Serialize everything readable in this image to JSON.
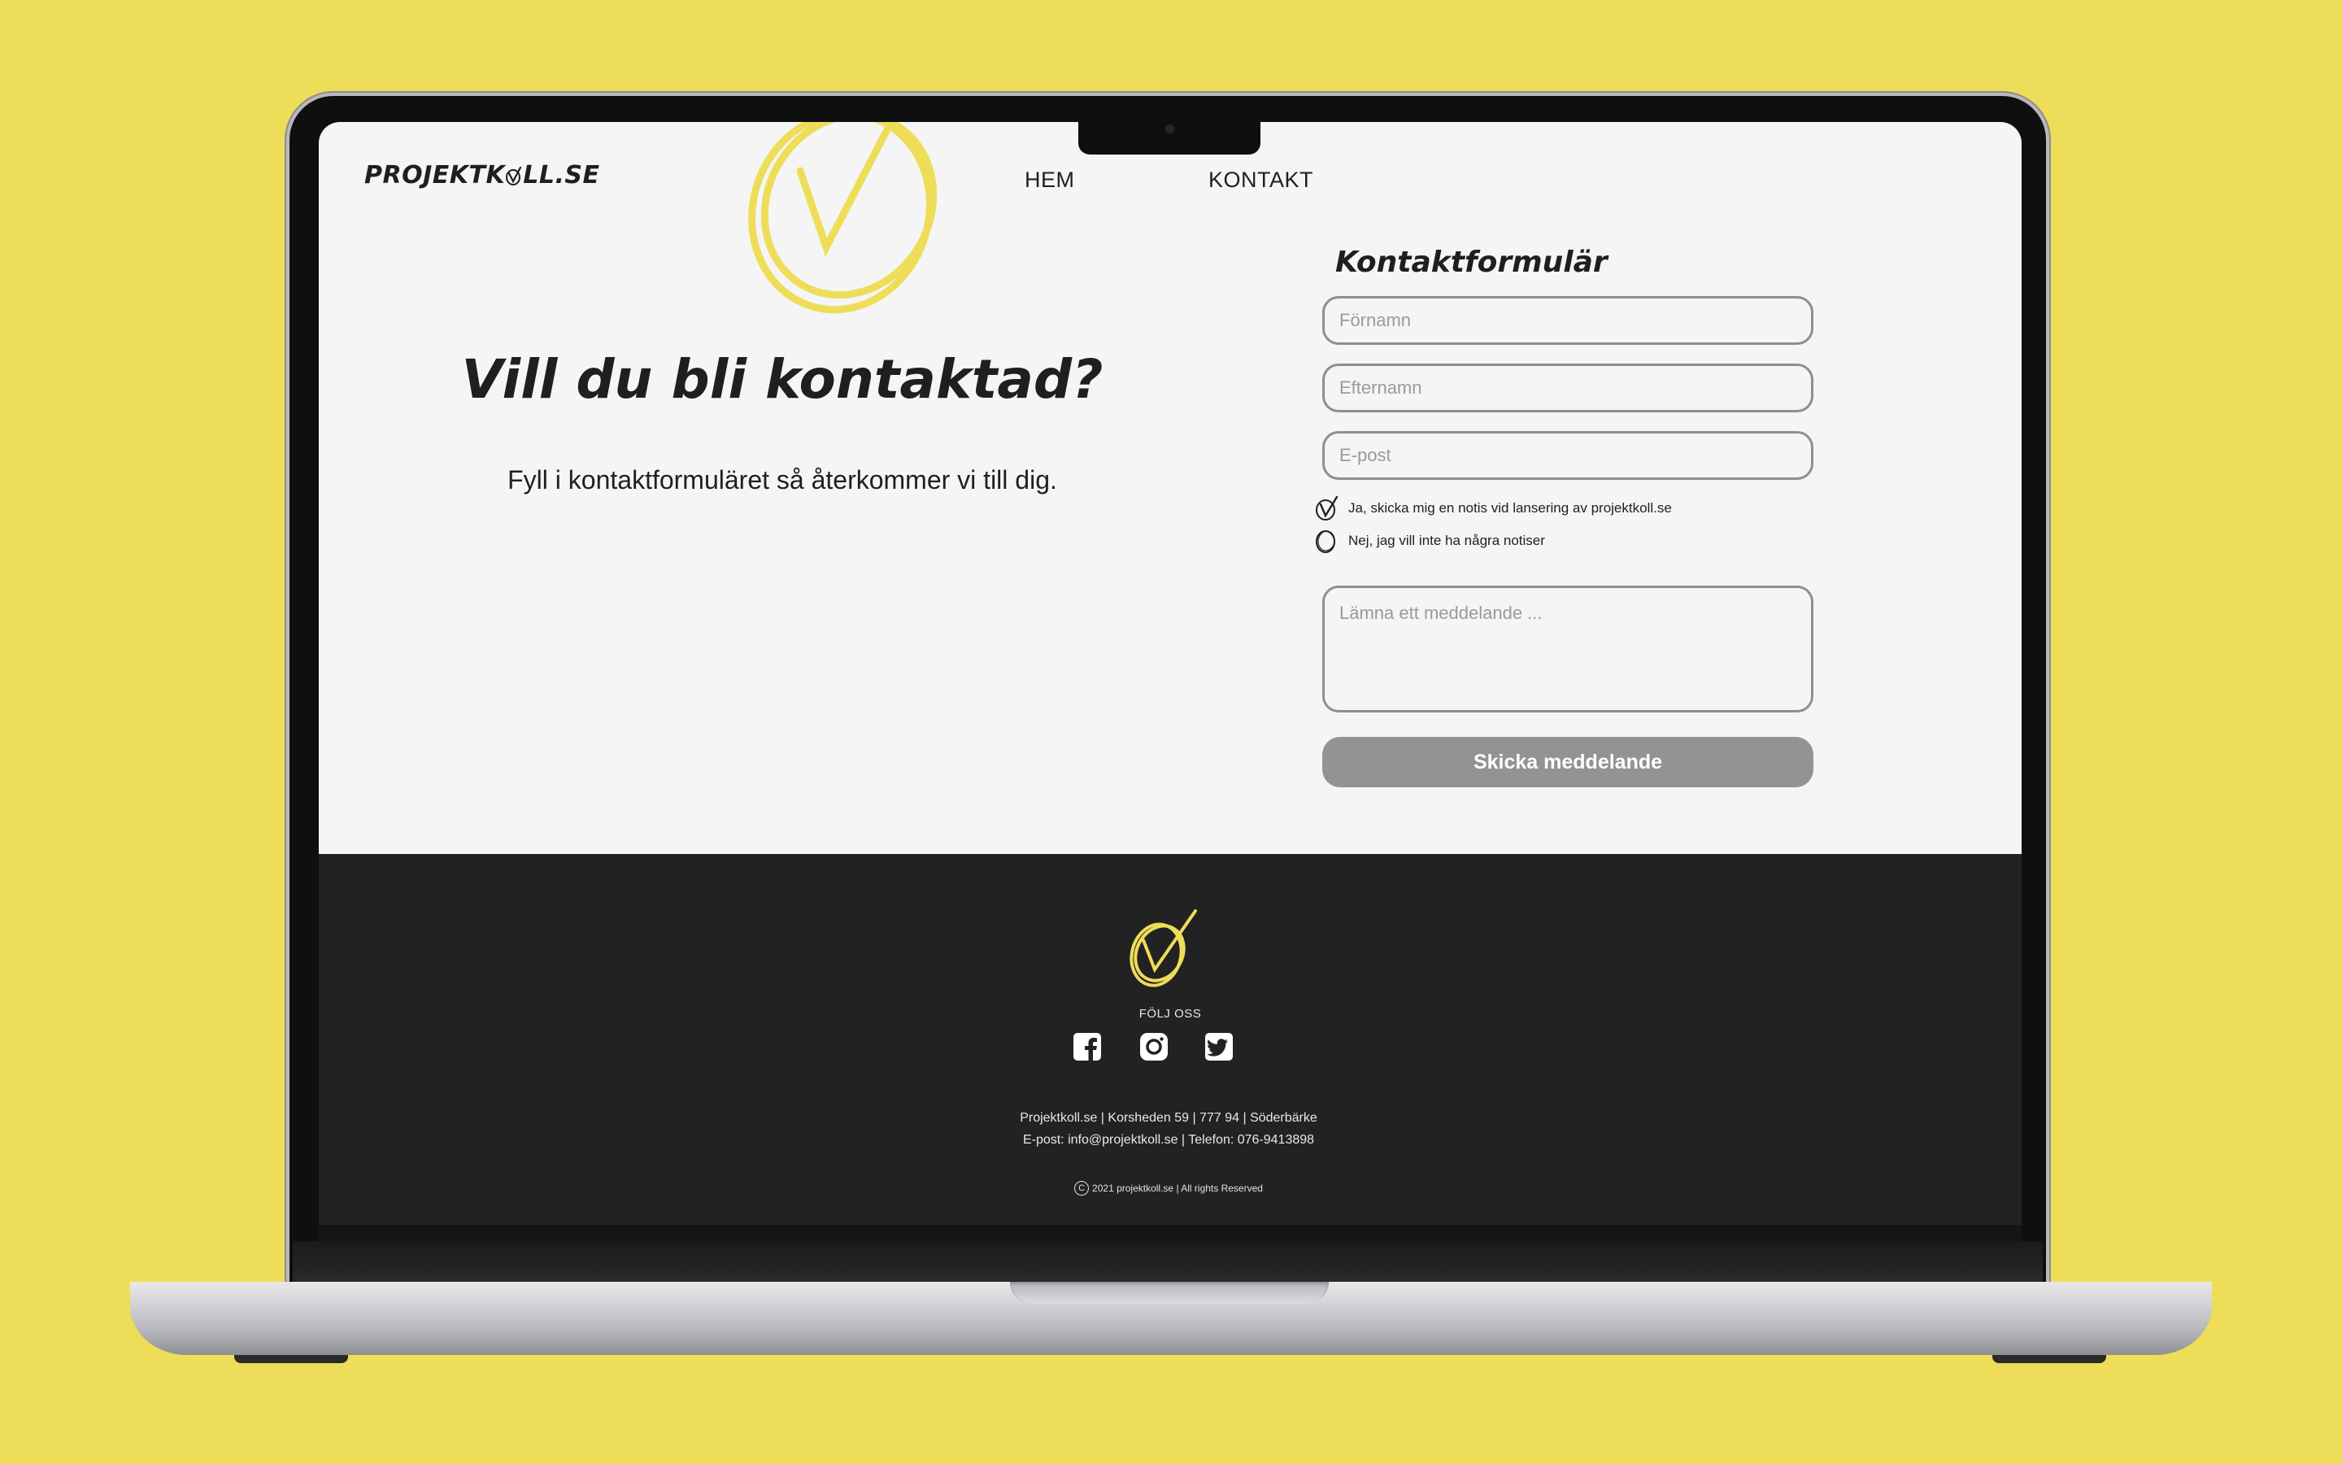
{
  "colors": {
    "background": "#EEDD58",
    "accent_yellow": "#EEDD58",
    "page_bg": "#F5F5F5",
    "footer_bg": "#222222",
    "button_bg": "#939393",
    "text": "#1f1f1f"
  },
  "header": {
    "brand_prefix": "PROJEKTK",
    "brand_suffix": "LL.SE",
    "nav": [
      "HEM",
      "KONTAKT"
    ]
  },
  "hero": {
    "headline": "Vill du bli kontaktad?",
    "subline": "Fyll i kontaktformuläret så återkommer vi till dig."
  },
  "form": {
    "title": "Kontaktformulär",
    "first_name_placeholder": "Förnamn",
    "last_name_placeholder": "Efternamn",
    "email_placeholder": "E-post",
    "options": [
      {
        "label": "Ja, skicka mig en notis vid lansering av projektkoll.se",
        "checked": true
      },
      {
        "label": "Nej, jag vill inte ha några notiser",
        "checked": false
      }
    ],
    "message_placeholder": "Lämna ett meddelande ...",
    "submit_label": "Skicka meddelande"
  },
  "footer": {
    "follow_label": "FÖLJ OSS",
    "social_icons": [
      "facebook-icon",
      "instagram-icon",
      "twitter-icon"
    ],
    "address_line": "Projektkoll.se |  Korsheden 59  | 777 94  |  Söderbärke",
    "contact_line": "E-post: info@projektkoll.se  |  Telefon: 076-9413898",
    "copyright_symbol": "C",
    "copyright": "2021 projektkoll.se | All rights Reserved"
  }
}
